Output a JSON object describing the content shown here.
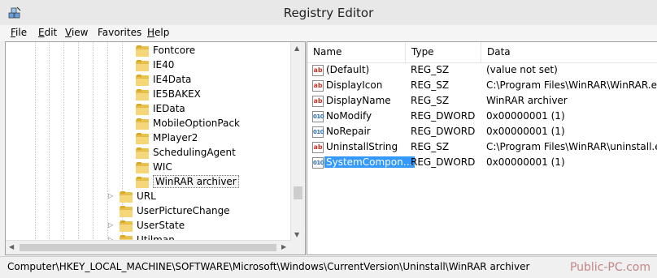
{
  "window": {
    "title": "Registry Editor",
    "icon": "registry-editor-icon"
  },
  "menu": [
    {
      "key": "F",
      "rest": "ile"
    },
    {
      "key": "E",
      "rest": "dit"
    },
    {
      "key": "V",
      "rest": "iew"
    },
    {
      "key": "",
      "rest": "Favorites"
    },
    {
      "key": "H",
      "rest": "elp"
    }
  ],
  "tree": {
    "children_of_uninstall_parent": [
      "Fontcore",
      "IE40",
      "IE4Data",
      "IE5BAKEX",
      "IEData",
      "MobileOptionPack",
      "MPlayer2",
      "SchedulingAgent",
      "WIC",
      "WinRAR archiver"
    ],
    "selected": "WinRAR archiver",
    "siblings": [
      "URL",
      "UserPictureChange",
      "UserState",
      "Utilman"
    ],
    "collapsed_arrow": "▷"
  },
  "values": {
    "columns": [
      "Name",
      "Type",
      "Data"
    ],
    "rows": [
      {
        "icon": "ab",
        "kind": "string-value-icon",
        "name": "(Default)",
        "type": "REG_SZ",
        "data": "(value not set)"
      },
      {
        "icon": "ab",
        "kind": "string-value-icon",
        "name": "DisplayIcon",
        "type": "REG_SZ",
        "data": "C:\\Program Files\\WinRAR\\WinRAR.exe"
      },
      {
        "icon": "ab",
        "kind": "string-value-icon",
        "name": "DisplayName",
        "type": "REG_SZ",
        "data": "WinRAR archiver"
      },
      {
        "icon": "010",
        "kind": "dword-value-icon",
        "name": "NoModify",
        "type": "REG_DWORD",
        "data": "0x00000001 (1)"
      },
      {
        "icon": "010",
        "kind": "dword-value-icon",
        "name": "NoRepair",
        "type": "REG_DWORD",
        "data": "0x00000001 (1)"
      },
      {
        "icon": "ab",
        "kind": "string-value-icon",
        "name": "UninstallString",
        "type": "REG_SZ",
        "data": "C:\\Program Files\\WinRAR\\uninstall.exe"
      },
      {
        "icon": "010",
        "kind": "dword-value-icon",
        "name": "SystemCompon…",
        "type": "REG_DWORD",
        "data": "0x00000001 (1)",
        "selected": true
      }
    ]
  },
  "status": {
    "path": "Computer\\HKEY_LOCAL_MACHINE\\SOFTWARE\\Microsoft\\Windows\\CurrentVersion\\Uninstall\\WinRAR archiver"
  },
  "watermark": "Public-PC.com",
  "colors": {
    "selection": "#3399ff",
    "folder": "#f5d77a",
    "string_icon": "#c0392b",
    "dword_icon": "#2e6db4"
  }
}
